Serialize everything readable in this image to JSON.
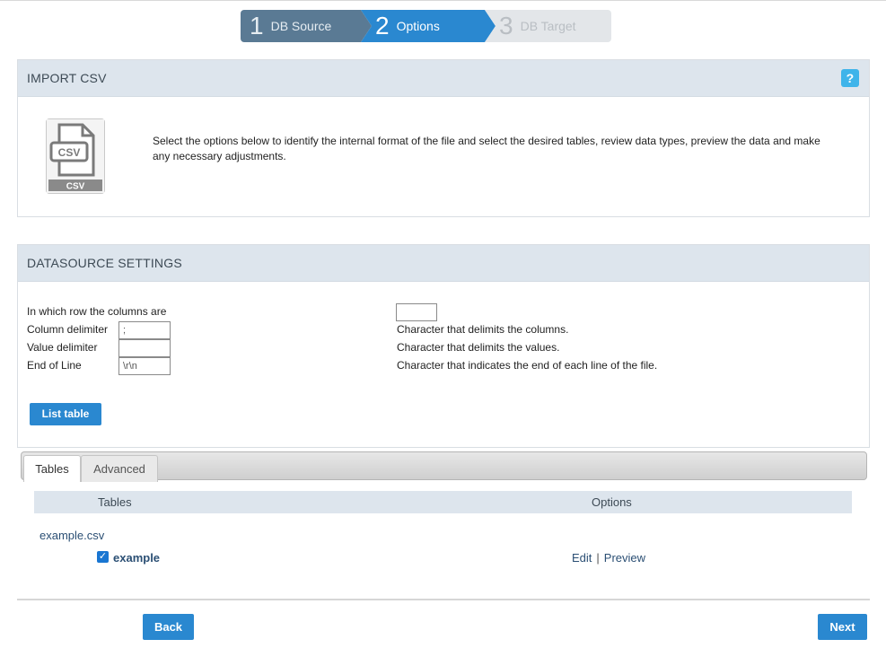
{
  "wizard": {
    "steps": [
      {
        "num": "1",
        "label": "DB Source"
      },
      {
        "num": "2",
        "label": "Options"
      },
      {
        "num": "3",
        "label": "DB Target"
      }
    ]
  },
  "import_panel": {
    "title": "IMPORT CSV",
    "help_label": "?",
    "icon_text": "CSV",
    "description": "Select the options below to identify the internal format of the file and select the desired tables, review data types, preview the data and make any necessary adjustments."
  },
  "datasource": {
    "title": "DATASOURCE SETTINGS",
    "rows": [
      {
        "label": "In which row the columns are",
        "value": "",
        "hint": ""
      },
      {
        "label": "Column delimiter",
        "value": ";",
        "hint": "Character that delimits the columns."
      },
      {
        "label": "Value delimiter",
        "value": "",
        "hint": "Character that delimits the values."
      },
      {
        "label": "End of Line",
        "value": "\\r\\n",
        "hint": "Character that indicates the end of each line of the file."
      }
    ],
    "list_table_button": "List table"
  },
  "tabs": [
    {
      "label": "Tables",
      "active": true
    },
    {
      "label": "Advanced",
      "active": false
    }
  ],
  "table": {
    "headers": [
      "Tables",
      "Options"
    ],
    "file": "example.csv",
    "items": [
      {
        "name": "example",
        "checked": true,
        "edit": "Edit",
        "preview": "Preview"
      }
    ]
  },
  "footer": {
    "back": "Back",
    "next": "Next"
  },
  "colors": {
    "primary": "#2a88d0",
    "step_done": "#5a7a94",
    "step_pending": "#e3e6e9",
    "panel_header": "#dde5ed",
    "help": "#3fb4ea"
  }
}
